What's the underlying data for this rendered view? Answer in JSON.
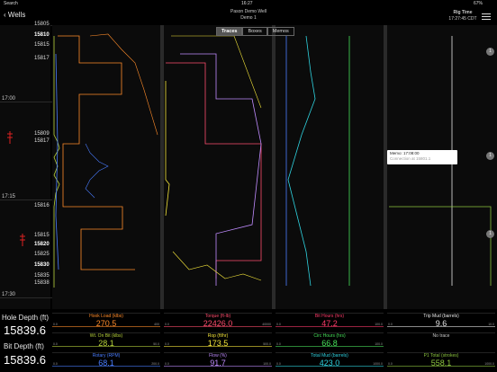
{
  "status_bar": {
    "carrier": "Search",
    "time": "16:27",
    "battery": "67%"
  },
  "header": {
    "back_label": "Wells",
    "well_name": "Pason Demo Well",
    "subtitle": "Demo 1",
    "rig_time_label": "Rig Time",
    "rig_time": "17:27:45 CDT"
  },
  "tabs": [
    {
      "label": "Traces"
    },
    {
      "label": "Boxes"
    },
    {
      "label": "Memos"
    }
  ],
  "time_labels": [
    "17:00",
    "17:15",
    "17:30"
  ],
  "depth_labels": {
    "group1": [
      "15805",
      "15810",
      "15815",
      "15817"
    ],
    "group2": [
      "15809",
      "15817"
    ],
    "group3": [
      "15816",
      "15815",
      "15820",
      "15825",
      "15830",
      "15835",
      "15838"
    ]
  },
  "summary": {
    "hole_depth_label": "Hole Depth (ft)",
    "hole_depth": "15839.6",
    "bit_depth_label": "Bit Depth (ft)",
    "bit_depth": "15839.6"
  },
  "readouts": [
    {
      "title": "Hook Load (klbs)",
      "value": "270.5",
      "min": "0.0",
      "max": "400",
      "color": "#ff8c2a"
    },
    {
      "title": "Torque (ft-lb)",
      "value": "22426.0",
      "min": "0.0",
      "max": "40000",
      "color": "#ff4d6d"
    },
    {
      "title": "Bit Hours (hrs)",
      "value": "47.2",
      "min": "0.0",
      "max": "100.0",
      "color": "#ff3b6a"
    },
    {
      "title": "Trip Mud (barrels)",
      "value": "9.6",
      "min": "0.0",
      "max": "10.0",
      "color": "#e6e6e6"
    },
    {
      "title": "Wt. On Bit (klbs)",
      "value": "28.1",
      "min": "0.0",
      "max": "50.0",
      "color": "#b6d13a"
    },
    {
      "title": "Rop (ft/hr)",
      "value": "173.5",
      "min": "0.0",
      "max": "500.0",
      "color": "#f5e63a"
    },
    {
      "title": "Circ Hours (hrs)",
      "value": "66.8",
      "min": "0.0",
      "max": "100.0",
      "color": "#47e05a"
    },
    {
      "title": "No trace",
      "value": "",
      "min": "",
      "max": "",
      "color": "#cccccc"
    },
    {
      "title": "Rotary (RPM)",
      "value": "68.1",
      "min": "0.0",
      "max": "200.0",
      "color": "#4a7dff"
    },
    {
      "title": "Flow (%)",
      "value": "91.7",
      "min": "0.0",
      "max": "100.0",
      "color": "#c08cff"
    },
    {
      "title": "Total Mud (barrels)",
      "value": "423.0",
      "min": "0.0",
      "max": "1000.0",
      "color": "#2fd3e0"
    },
    {
      "title": "P1 Total (strokes)",
      "value": "558.1",
      "min": "0.0",
      "max": "1000.0",
      "color": "#8dc63f"
    }
  ],
  "memo": {
    "title": "Memo: 17:08:00",
    "detail": "Connection at 15801.1"
  },
  "badges": [
    "1",
    "1",
    "1"
  ]
}
